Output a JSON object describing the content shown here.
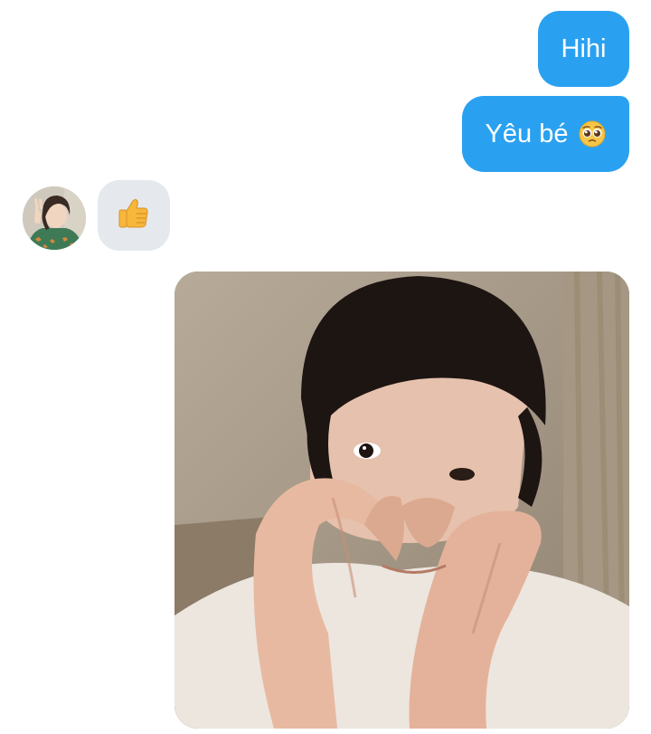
{
  "messages": {
    "outgoing_1": {
      "text": "Hihi"
    },
    "outgoing_2": {
      "text": "Yêu bé",
      "emoji": "pleading-face"
    },
    "incoming_reaction": {
      "emoji": "thumbs-up"
    },
    "incoming_photo": {
      "kind": "photo",
      "subject": "person-making-heart-hands"
    }
  },
  "colors": {
    "outgoing_bubble": "#2aa1f0",
    "incoming_bubble": "#e5e9ed",
    "background": "#ffffff"
  }
}
